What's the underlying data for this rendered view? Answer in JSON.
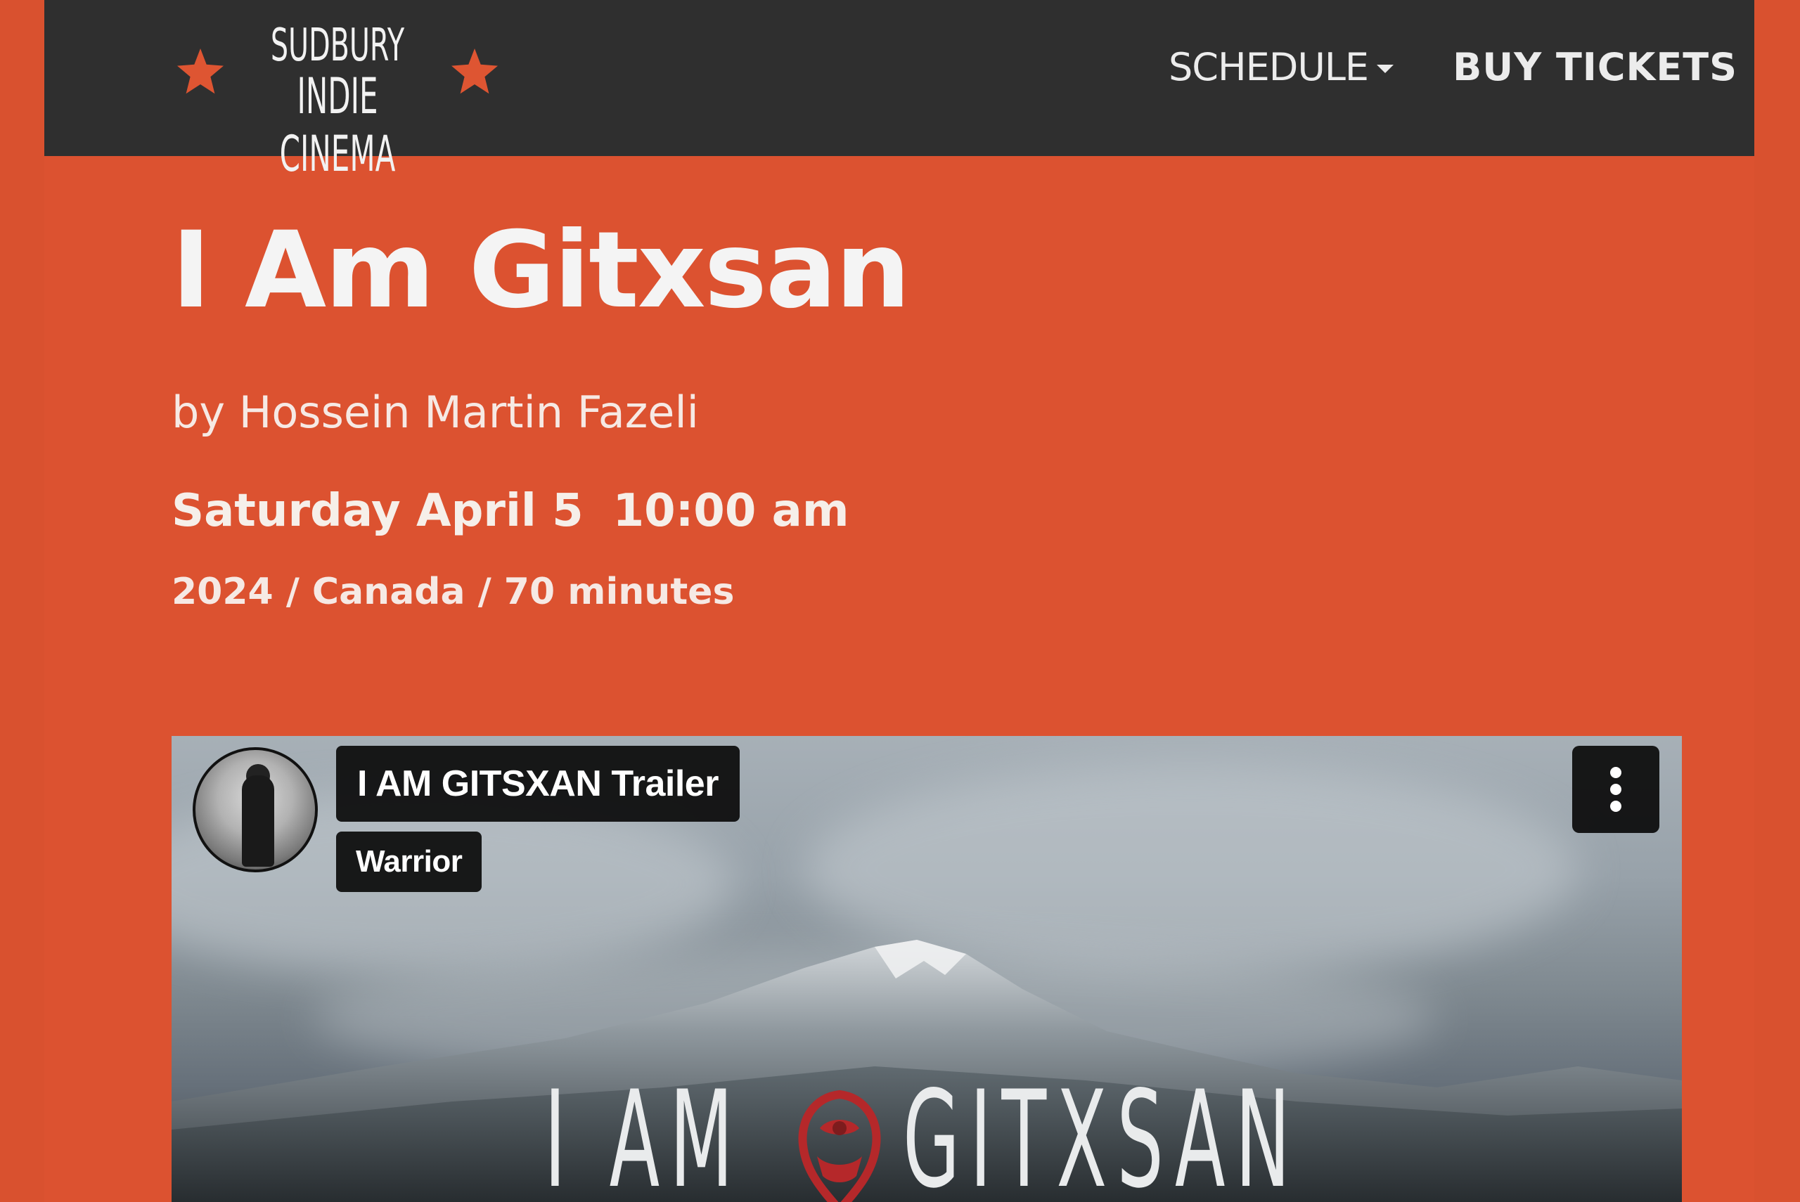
{
  "colors": {
    "page_bg": "#d9512f",
    "navbar_bg": "#2f2f2f",
    "accent_star": "#de5532",
    "text_light": "#f4f4f4"
  },
  "navbar": {
    "logo": {
      "line1": "SUDBURY",
      "line2": "INDIE CINEMA",
      "icons": [
        "star-icon",
        "star-icon"
      ]
    },
    "links": [
      {
        "label": "SCHEDULE",
        "has_dropdown": true
      },
      {
        "label": "BUY TICKETS",
        "has_dropdown": false
      }
    ]
  },
  "film": {
    "title": "I Am Gitxsan",
    "director": "by Hossein Martin Fazeli",
    "showtime_day": "Saturday April 5",
    "showtime_time": "10:00 am",
    "meta": "2024 / Canada / 70 minutes"
  },
  "video": {
    "title": "I AM GITSXAN Trailer",
    "channel": "Warrior",
    "poster_word_1": "I AM",
    "poster_word_2": "GITXSAN",
    "menu_icon": "more-vertical-icon"
  }
}
